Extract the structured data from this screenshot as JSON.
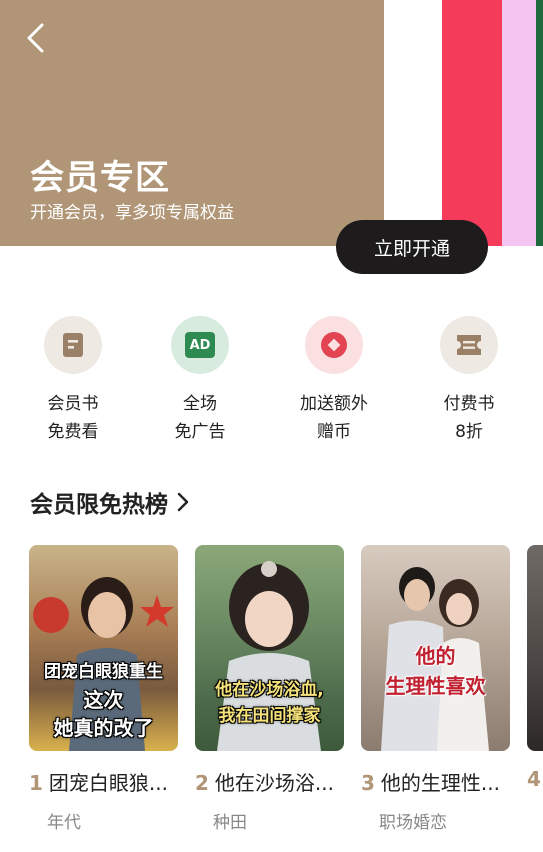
{
  "hero": {
    "title": "会员专区",
    "subtitle": "开通会员，享多项专属权益",
    "open_button": "立即开通",
    "bg_color": "#b09577"
  },
  "benefits": [
    {
      "line1": "会员书",
      "line2": "免费看",
      "icon": "book-icon",
      "icon_text": "",
      "bg": "#efe9e3",
      "fg": "#9a8066"
    },
    {
      "line1": "全场",
      "line2": "免广告",
      "icon": "ad-icon",
      "icon_text": "AD",
      "bg": "#d8ebdf",
      "fg": "#2d8a51"
    },
    {
      "line1": "加送额外",
      "line2": "赠币",
      "icon": "coin-icon",
      "icon_text": "",
      "bg": "#fbe0e2",
      "fg": "#e24452"
    },
    {
      "line1": "付费书",
      "line2": "8折",
      "icon": "ticket-icon",
      "icon_text": "",
      "bg": "#efe9e3",
      "fg": "#9a8066"
    }
  ],
  "section": {
    "title": "会员限免热榜"
  },
  "books": [
    {
      "rank": "1",
      "title": "团宠白眼狼...",
      "genre": "年代",
      "cover_lines": [
        "团宠白眼狼重生",
        "这次",
        "她真的改了"
      ]
    },
    {
      "rank": "2",
      "title": "他在沙场浴...",
      "genre": "种田",
      "cover_lines": [
        "他在沙场浴血,",
        "我在田间撑家"
      ]
    },
    {
      "rank": "3",
      "title": "他的生理性...",
      "genre": "职场婚恋",
      "cover_lines": [
        "他的",
        "生理性喜欢"
      ]
    },
    {
      "rank": "4",
      "title": "",
      "genre": "",
      "cover_lines": []
    }
  ]
}
